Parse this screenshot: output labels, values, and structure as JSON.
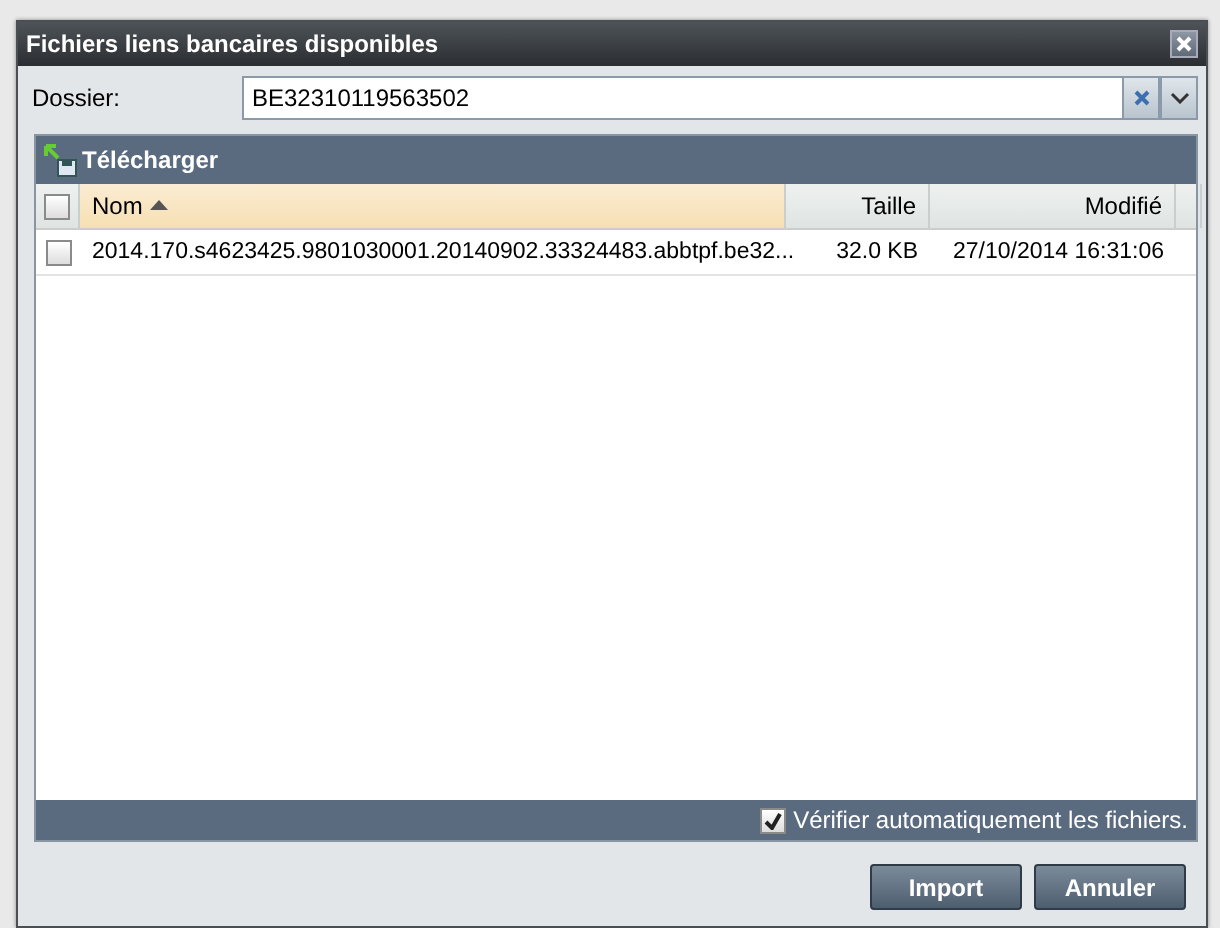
{
  "window": {
    "title": "Fichiers liens bancaires disponibles"
  },
  "folder": {
    "label": "Dossier:",
    "value": "BE32310119563502"
  },
  "toolbar": {
    "download_label": "Télécharger"
  },
  "table": {
    "select_all_checked": false,
    "columns": [
      {
        "label": "Nom",
        "sorted": true
      },
      {
        "label": "Taille",
        "sorted": false
      },
      {
        "label": "Modifié",
        "sorted": false
      }
    ],
    "rows": [
      {
        "checked": false,
        "cells": [
          "2014.170.s4623425.9801030001.20140902.33324483.abbtpf.be32...",
          "32.0 KB",
          "27/10/2014 16:31:06"
        ]
      }
    ]
  },
  "footer": {
    "auto_verify": {
      "label": "Vérifier automatiquement les fichiers.",
      "checked": true
    }
  },
  "buttons": [
    {
      "label": "Import"
    },
    {
      "label": "Annuler"
    }
  ]
}
